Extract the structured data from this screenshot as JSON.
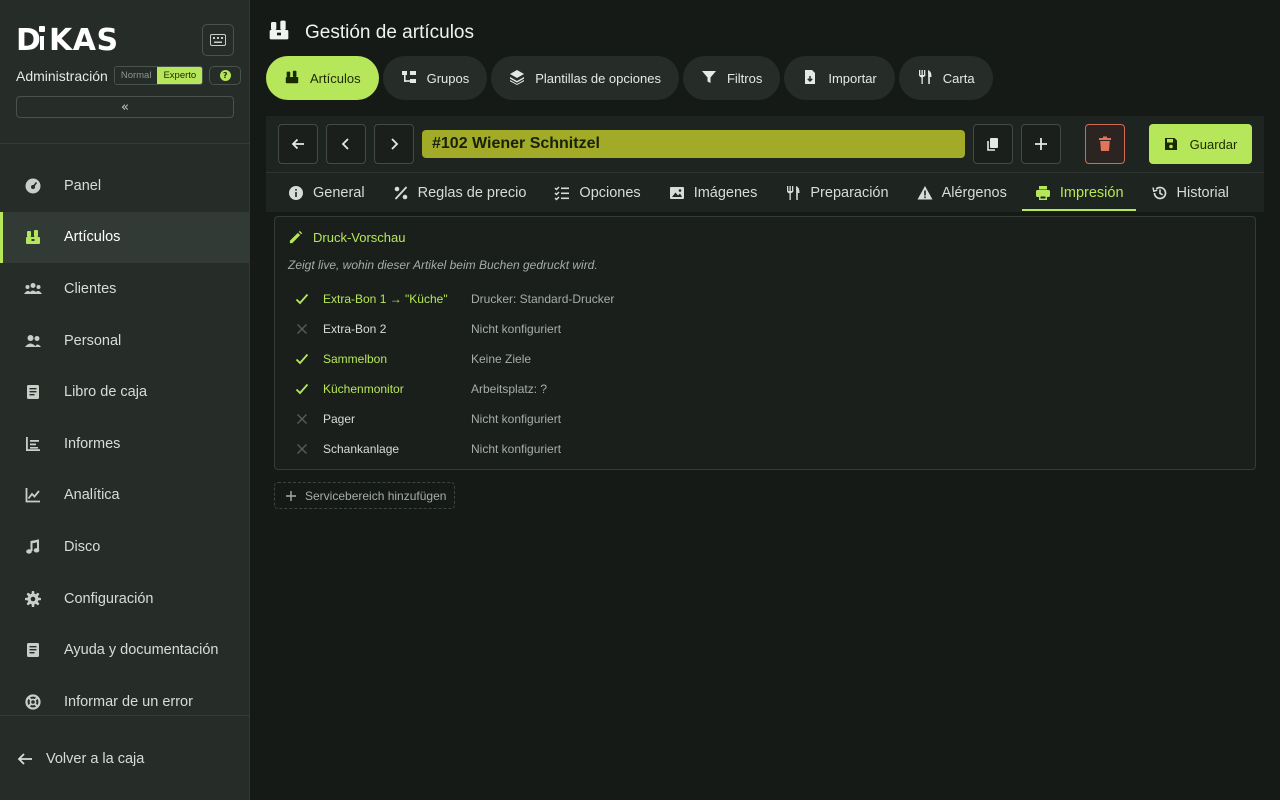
{
  "brand": {
    "logo": "D KAS",
    "accent": "#b6e65a"
  },
  "sidebar": {
    "admin_label": "Administración",
    "mode_normal": "Normal",
    "mode_expert": "Experto",
    "collapse_glyph": "«",
    "items": [
      {
        "label": "Panel",
        "icon": "dashboard-icon"
      },
      {
        "label": "Artículos",
        "icon": "articles-icon",
        "active": true
      },
      {
        "label": "Clientes",
        "icon": "customers-icon"
      },
      {
        "label": "Personal",
        "icon": "staff-icon"
      },
      {
        "label": "Libro de caja",
        "icon": "cashbook-icon"
      },
      {
        "label": "Informes",
        "icon": "reports-icon"
      },
      {
        "label": "Analítica",
        "icon": "analytics-icon"
      },
      {
        "label": "Disco",
        "icon": "music-icon"
      },
      {
        "label": "Configuración",
        "icon": "gear-icon"
      },
      {
        "label": "Ayuda y documentación",
        "icon": "help-book-icon"
      },
      {
        "label": "Informar de un error",
        "icon": "lifebuoy-icon"
      }
    ],
    "back_label": "Volver a la caja"
  },
  "header": {
    "title": "Gestión de artículos"
  },
  "tabs": [
    {
      "label": "Artículos",
      "active": true
    },
    {
      "label": "Grupos"
    },
    {
      "label": "Plantillas de opciones"
    },
    {
      "label": "Filtros"
    },
    {
      "label": "Importar"
    },
    {
      "label": "Carta"
    }
  ],
  "editor": {
    "item_title": "#102 Wiener Schnitzel",
    "save_label": "Guardar",
    "subtabs": [
      {
        "label": "General"
      },
      {
        "label": "Reglas de precio"
      },
      {
        "label": "Opciones"
      },
      {
        "label": "Imágenes"
      },
      {
        "label": "Preparación"
      },
      {
        "label": "Alérgenos"
      },
      {
        "label": "Impresión",
        "active": true
      },
      {
        "label": "Historial"
      }
    ]
  },
  "preview": {
    "title": "Druck-Vorschau",
    "description": "Zeigt live, wohin dieser Artikel beim Buchen gedruckt wird.",
    "rows": [
      {
        "target": "Extra-Bon 1 → \"Küche\"",
        "detail": "Drucker: Standard-Drucker",
        "ok": true
      },
      {
        "target": "Extra-Bon 2",
        "detail": "Nicht konfiguriert",
        "ok": false
      },
      {
        "target": "Sammelbon",
        "detail": "Keine Ziele",
        "ok": true
      },
      {
        "target": "Küchenmonitor",
        "detail": "Arbeitsplatz: ?",
        "ok": true
      },
      {
        "target": "Pager",
        "detail": "Nicht konfiguriert",
        "ok": false
      },
      {
        "target": "Schankanlage",
        "detail": "Nicht konfiguriert",
        "ok": false
      }
    ],
    "add_label": "Servicebereich hinzufügen"
  }
}
